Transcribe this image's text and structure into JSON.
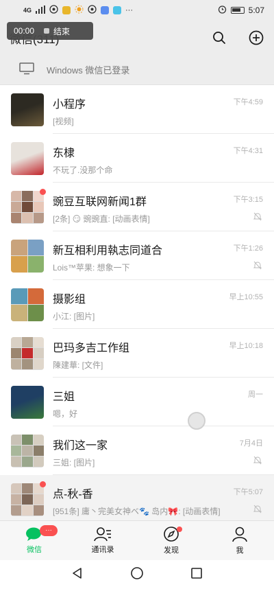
{
  "status_bar": {
    "left_icons": [
      "signal-4g-icon",
      "signal-bars-icon",
      "hotspot-icon",
      "app-yellow-icon",
      "app-sun-icon",
      "app-red-icon",
      "app-blue-icon",
      "app-blue2-icon",
      "more-dots-icon"
    ],
    "signal_label": "4G",
    "more_label": "···",
    "time": "5:07"
  },
  "header": {
    "title": "微信(311)",
    "search_icon": "search-icon",
    "add_icon": "plus-circle-icon"
  },
  "call_pill": {
    "timer": "00:00",
    "end_label": "结束"
  },
  "login_banner": {
    "icon": "monitor-icon",
    "text": "Windows 微信已登录"
  },
  "chats": [
    {
      "name": "小程序",
      "msg": "[视频]",
      "time": "下午4:59",
      "muted": false,
      "dot": false,
      "avatar_colors": [
        "#2d2a22",
        "#6b5a3a"
      ]
    },
    {
      "name": "东棣",
      "msg": "不玩了.没那个命",
      "time": "下午4:31",
      "muted": false,
      "dot": false,
      "avatar_colors": [
        "#e7e2dc",
        "#c2242a"
      ]
    },
    {
      "name": "豌豆互联网新闻1群",
      "msg": "[2条] 😏 豌豌直: [动画表情]",
      "time": "下午3:15",
      "muted": true,
      "dot": true,
      "avatar_colors": [
        "#d7b8a8",
        "#8a6d5c",
        "#f1d6cc",
        "#c9a996",
        "#704b3a",
        "#e8c7b8",
        "#a98470",
        "#dcc0b0",
        "#b79988"
      ]
    },
    {
      "name": "新互相利用執志同道合",
      "msg": "Lois™苹果: 想象一下",
      "time": "下午1:26",
      "muted": true,
      "dot": false,
      "avatar_colors": [
        "#c9a37c",
        "#7aa0c4",
        "#d8a04c",
        "#8ab26c"
      ]
    },
    {
      "name": "摄影组",
      "msg": "小江: [图片]",
      "time": "早上10:55",
      "muted": false,
      "dot": false,
      "avatar_colors": [
        "#5a9ab8",
        "#d46a3a",
        "#c9b27a",
        "#6d8f4a"
      ]
    },
    {
      "name": "巴玛多吉工作组",
      "msg": "陳建華: [文件]",
      "time": "早上10:18",
      "muted": false,
      "dot": false,
      "avatar_colors": [
        "#d9d0c4",
        "#b8a894",
        "#e6ddd2",
        "#9c8670",
        "#c42b2b",
        "#d7cec2",
        "#bfb19f",
        "#a3937f",
        "#e0d7cb"
      ]
    },
    {
      "name": "三姐",
      "msg": "嗯，好",
      "time": "周一",
      "muted": false,
      "dot": false,
      "avatar_colors": [
        "#1f3f63",
        "#3a7a3a"
      ]
    },
    {
      "name": "我们这一家",
      "msg": "三姐: [图片]",
      "time": "7月4日",
      "muted": true,
      "dot": false,
      "avatar_colors": [
        "#c9c2b6",
        "#7d8f6a",
        "#d7cfc2",
        "#a8b79a",
        "#bcb4a6",
        "#8b7e6a",
        "#c8c0b2",
        "#9aa78c",
        "#d2cabd"
      ]
    },
    {
      "name": "点-秋-香",
      "msg": "[951条] 庸丶完美女神ベ🐾 岛内🎀: [动画表情]",
      "time": "下午5:07",
      "muted": true,
      "dot": true,
      "pinned": true,
      "avatar_colors": [
        "#d6c7bb",
        "#9e8878",
        "#e6d8cd",
        "#c7b2a3",
        "#7d6657",
        "#ddcdc1",
        "#b39d8e",
        "#e2d2c6",
        "#a88f7f"
      ]
    }
  ],
  "tabs": [
    {
      "label": "微信",
      "icon": "chat-bubble-icon",
      "active": true,
      "badge": "···"
    },
    {
      "label": "通讯录",
      "icon": "contacts-icon",
      "active": false
    },
    {
      "label": "发现",
      "icon": "compass-icon",
      "active": false,
      "dot": true
    },
    {
      "label": "我",
      "icon": "person-icon",
      "active": false
    }
  ],
  "nav": {
    "back_icon": "back-triangle-icon",
    "home_icon": "home-circle-icon",
    "recent_icon": "recent-square-icon"
  },
  "colors": {
    "accent": "#07c160",
    "badge": "#fa5151",
    "background": "#ededed"
  }
}
